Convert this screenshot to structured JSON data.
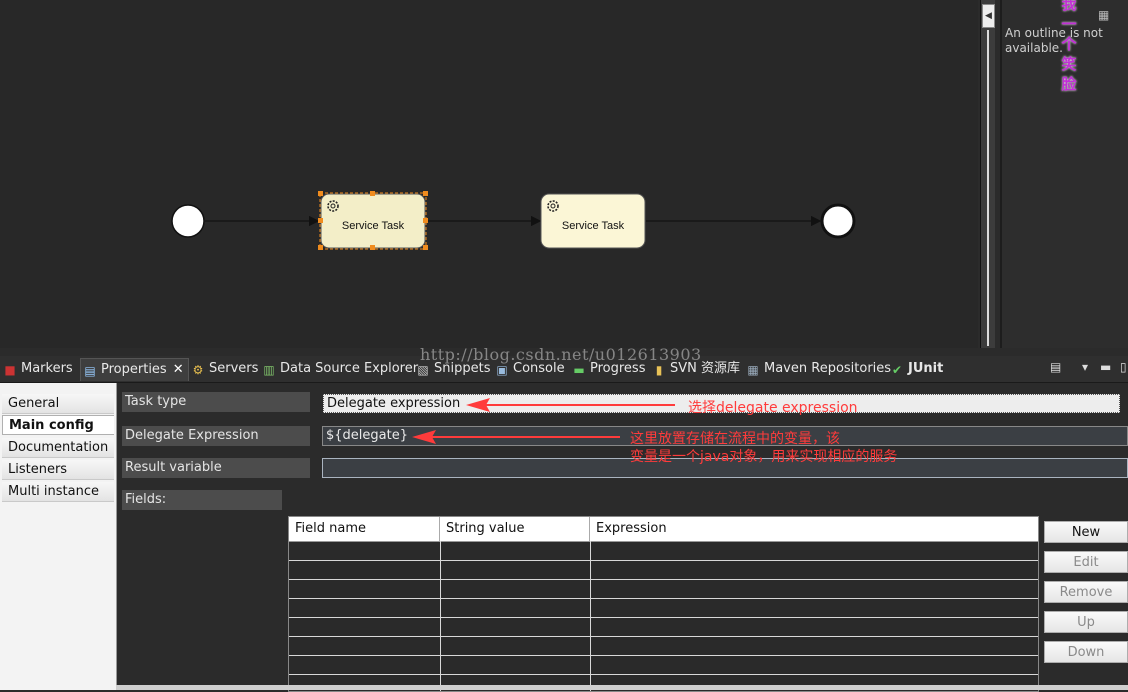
{
  "outline": {
    "message": "An outline is not available.",
    "watermark": "我一个笑脸"
  },
  "diagram": {
    "task1_label": "Service Task",
    "task2_label": "Service Task"
  },
  "tabs": [
    {
      "label": "Markers",
      "icon": "markers-icon"
    },
    {
      "label": "Properties",
      "icon": "properties-icon",
      "active": true
    },
    {
      "label": "Servers",
      "icon": "servers-icon"
    },
    {
      "label": "Data Source Explorer",
      "icon": "data-source-icon"
    },
    {
      "label": "Snippets",
      "icon": "snippets-icon"
    },
    {
      "label": "Console",
      "icon": "console-icon"
    },
    {
      "label": "Progress",
      "icon": "progress-icon"
    },
    {
      "label": "SVN 资源库",
      "icon": "svn-icon"
    },
    {
      "label": "Maven Repositories",
      "icon": "maven-icon"
    },
    {
      "label": "JUnit",
      "icon": "junit-icon"
    }
  ],
  "watermark_url": "http://blog.csdn.net/u012613903",
  "sidenav": {
    "items": [
      "General",
      "Main config",
      "Documentation",
      "Listeners",
      "Multi instance"
    ],
    "selected": "Main config"
  },
  "form": {
    "task_type_label": "Task type",
    "task_type_value": "Delegate expression",
    "delegate_expression_label": "Delegate Expression",
    "delegate_expression_value": "${delegate}",
    "result_variable_label": "Result variable",
    "result_variable_value": "",
    "fields_label": "Fields:"
  },
  "annotations": {
    "ann1": "选择delegate expression",
    "ann2_line1": "这里放置存储在流程中的变量，该",
    "ann2_line2": "变量是一个java对象，用来实现相应的服务"
  },
  "table": {
    "columns": [
      "Field name",
      "String value",
      "Expression"
    ],
    "rows": 8
  },
  "table_buttons": {
    "new": "New",
    "edit": "Edit",
    "remove": "Remove",
    "up": "Up",
    "down": "Down"
  },
  "colors": {
    "annotation_red": "#ff3b3b",
    "task_fill": "#fbf6d6",
    "selection_handle": "#f08c1e"
  }
}
